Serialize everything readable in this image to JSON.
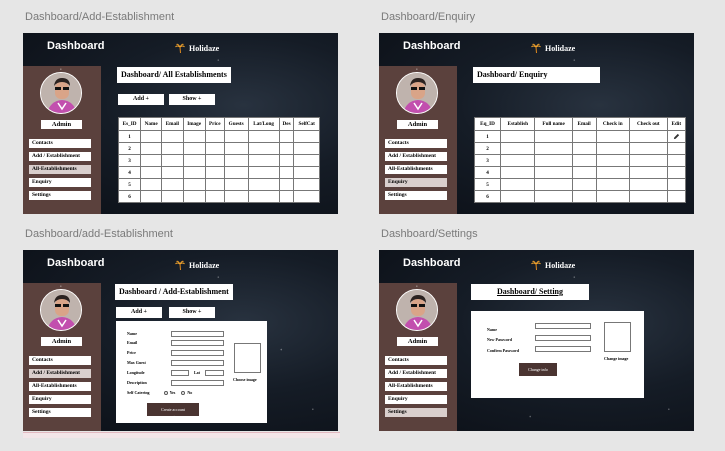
{
  "frames": {
    "f1": {
      "label": "Dashboard/Add-Establishment"
    },
    "f2": {
      "label": "Dashboard/Enquiry"
    },
    "f3": {
      "label": "Dashboard/add-Establishment"
    },
    "f4": {
      "label": "Dashboard/Settings"
    }
  },
  "app": {
    "header_title": "Dashboard",
    "brand_name": "Holidaze",
    "admin_label": "Admin"
  },
  "nav": {
    "contacts": "Contacts",
    "add_establishment": "Add / Establishment",
    "all_establishments": "All-Establishments",
    "enquiry": "Enquiry",
    "settings": "Settings"
  },
  "all_establishments": {
    "title": "Dashboard/ All Establishments",
    "add_button": "Add +",
    "show_button": "Show +",
    "columns": [
      "Es_ID",
      "Name",
      "Email",
      "Image",
      "Price",
      "Guests",
      "Lat/Long",
      "Des",
      "SelfCat"
    ],
    "rows": [
      "1",
      "2",
      "3",
      "4",
      "5",
      "6"
    ]
  },
  "enquiry": {
    "title": "Dashboard/ Enquiry",
    "columns": [
      "Eq_ID",
      "Establish",
      "Full name",
      "Email",
      "Check in",
      "Check out",
      "Edit"
    ],
    "rows": [
      "1",
      "2",
      "3",
      "4",
      "5",
      "6"
    ],
    "edit_icon": "pencil-icon"
  },
  "add_establishment": {
    "title": "Dashboard / Add-Establishment",
    "add_button": "Add +",
    "show_button": "Show +",
    "fields": {
      "name": "Name",
      "email": "Email",
      "price": "Price",
      "max_guest": "Max Guest",
      "longitude": "Longitude",
      "lat": "Lat",
      "description": "Description",
      "self_catering": "Self Catering",
      "yes": "Yes",
      "no": "No"
    },
    "choose_image": "Choose image",
    "create_button": "Create account"
  },
  "settings": {
    "title": "Dashboard/ Setting",
    "fields": {
      "name": "Name",
      "new_password": "New Password",
      "confirm_password": "Confirm Password"
    },
    "change_button": "Change info",
    "change_image": "Change image"
  },
  "colors": {
    "sidebar": "#5b413d",
    "accent_dark": "#4a3431",
    "page_bg": "#e6e6e6"
  }
}
